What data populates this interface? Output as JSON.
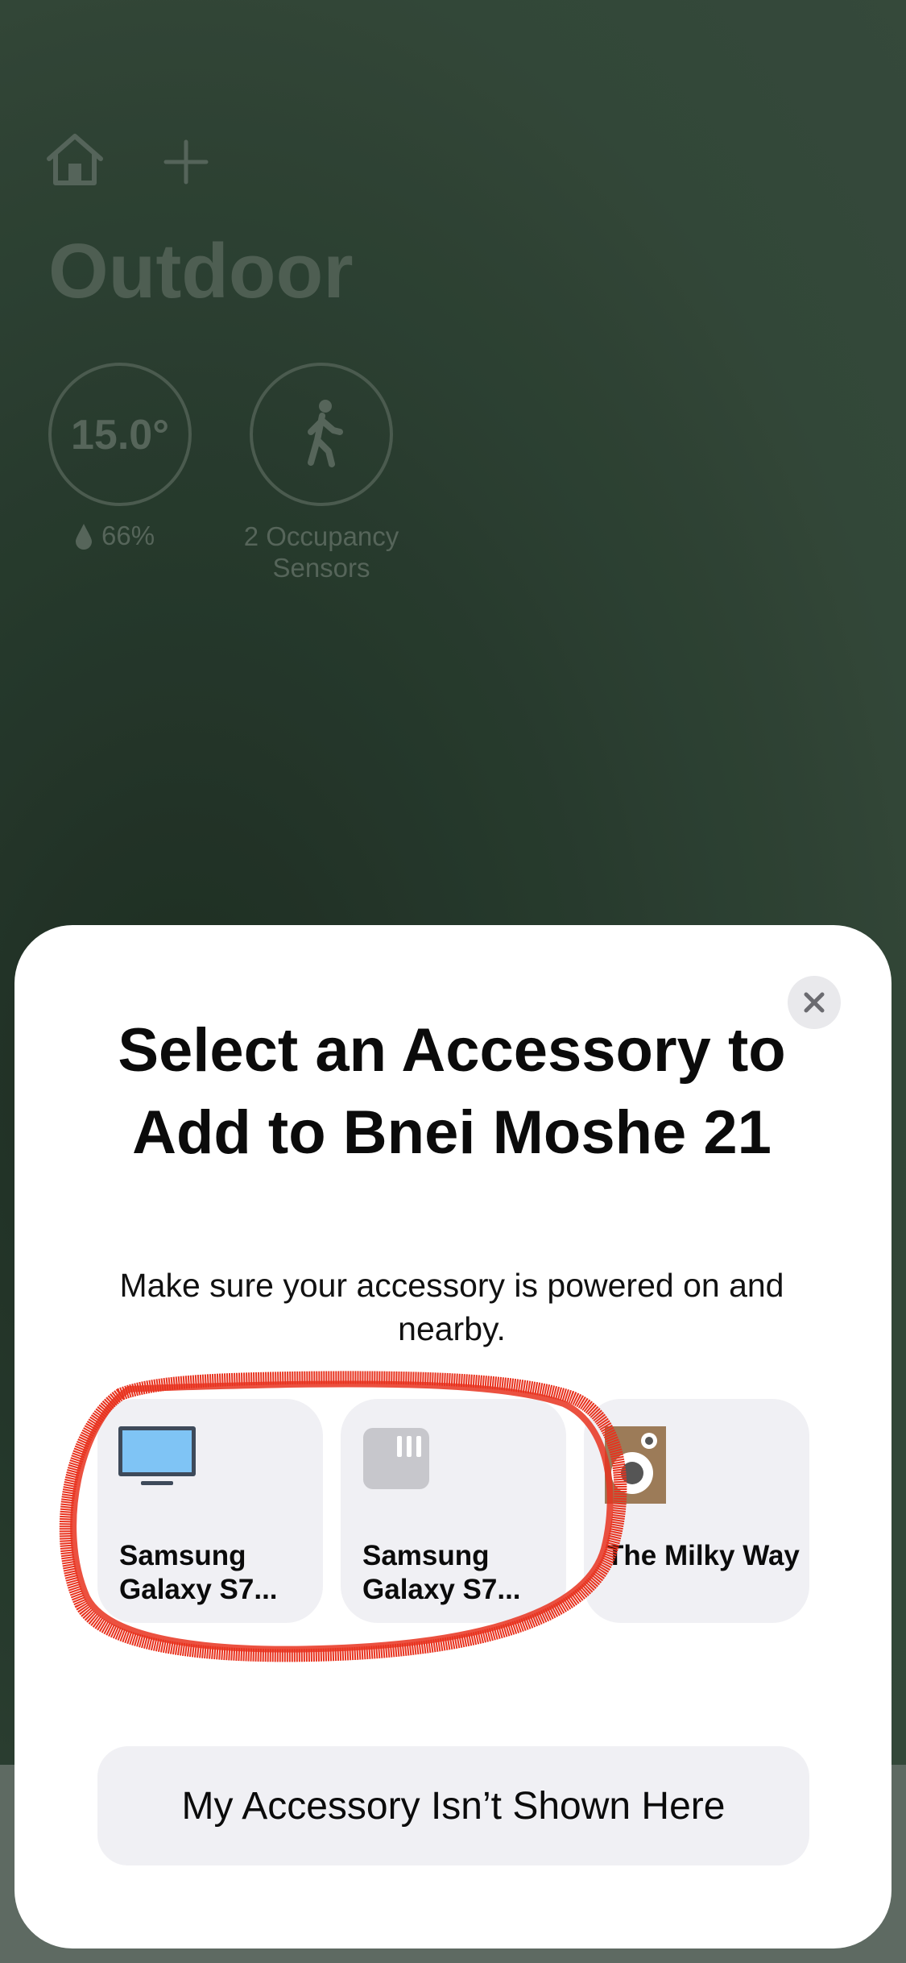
{
  "background": {
    "room_title": "Outdoor",
    "temperature": "15.0°",
    "humidity": "66%",
    "occupancy_label": "2 Occupancy Sensors",
    "icons": [
      "home-icon",
      "plus-icon",
      "drop-icon",
      "walking-person-icon"
    ]
  },
  "sheet": {
    "title": "Select an Accessory to Add to Bnei Moshe 21",
    "subtitle": "Make sure your accessory is powered on and nearby.",
    "close_icon": "close-icon",
    "accessories": [
      {
        "label": "Samsung Galaxy S7...",
        "icon": "tv-icon"
      },
      {
        "label": "Samsung Galaxy S7...",
        "icon": "device-icon"
      },
      {
        "label": "The Milky Way",
        "icon": "speaker-icon"
      }
    ],
    "bottom_button": "My Accessory Isn’t Shown Here"
  },
  "colors": {
    "background": "#2d4334",
    "sheet": "#ffffff",
    "card": "#f0f0f4",
    "annotation": "#e8321e"
  }
}
